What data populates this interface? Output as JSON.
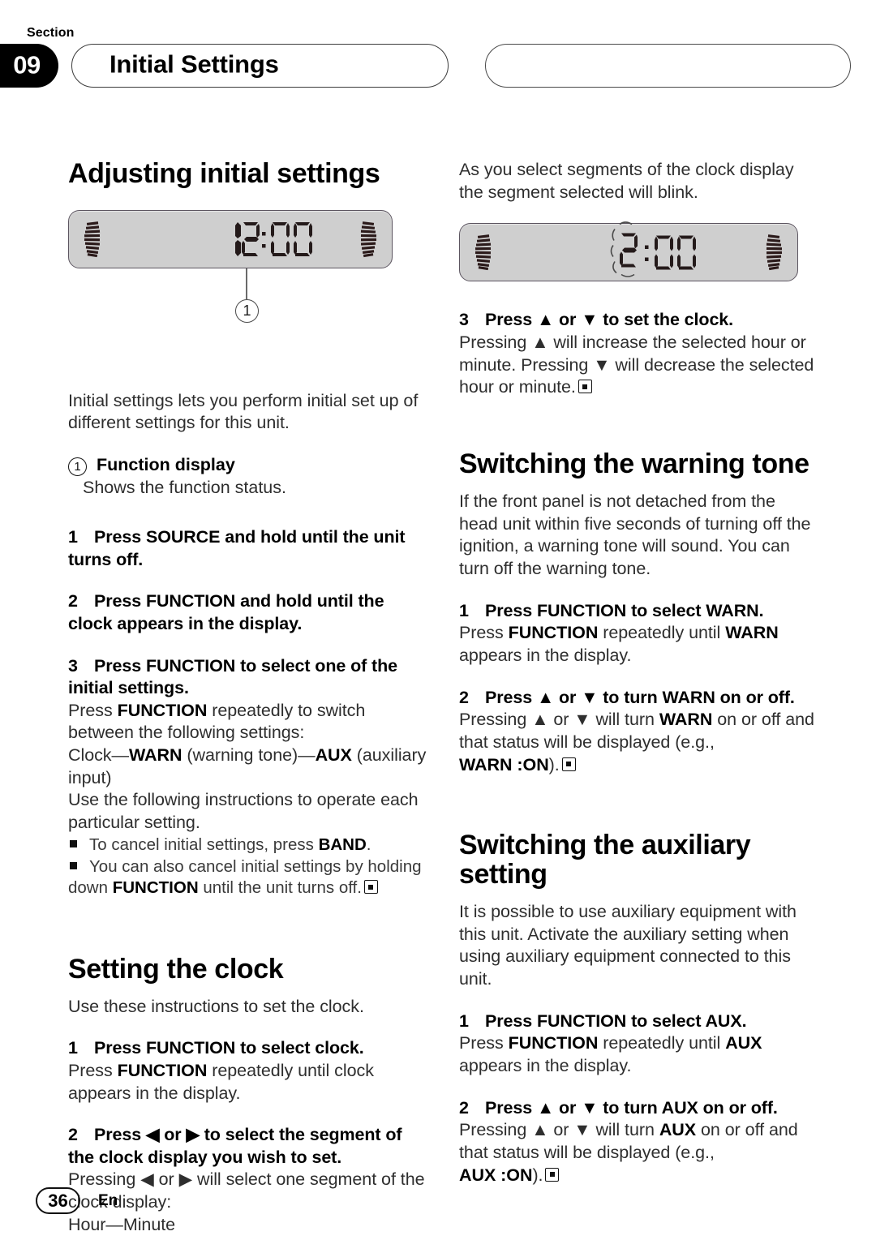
{
  "header": {
    "section_word": "Section",
    "section_number": "09",
    "title": "Initial Settings"
  },
  "left_column": {
    "heading": "Adjusting initial settings",
    "display": {
      "digits": "12:00",
      "callout_number": "1",
      "left_icon": "sound-wave-arc-icon",
      "right_icon": "sound-wave-arc-icon"
    },
    "intro": "Initial settings lets you perform initial set up of different settings for this unit.",
    "callout": {
      "marker": "1",
      "label": "Function display",
      "description": "Shows the function status."
    },
    "steps": [
      {
        "number": "1",
        "title_plain": "Press SOURCE and hold until the unit turns off.",
        "title_pre": "Press SOURCE and hold until the unit turns off."
      },
      {
        "number": "2",
        "title_plain": "Press FUNCTION and hold until the clock appears in the display."
      },
      {
        "number": "3",
        "title_plain": "Press FUNCTION to select one of the initial settings."
      }
    ],
    "step3_body": {
      "line1_a": "Press ",
      "line1_b": "FUNCTION",
      "line1_c": " repeatedly to switch between the following settings:",
      "settings_chain_a": "Clock—",
      "settings_chain_b": "WARN",
      "settings_chain_c": " (warning tone)—",
      "settings_chain_d": "AUX",
      "settings_chain_e": " (auxiliary input)",
      "line3": "Use the following instructions to operate each particular setting."
    },
    "notes": [
      {
        "a": "To cancel initial settings, press ",
        "b": "BAND",
        "c": "."
      },
      {
        "a": "You can also cancel initial settings by holding down ",
        "b": "FUNCTION",
        "c": " until the unit turns off."
      }
    ],
    "clock_section": {
      "heading": "Setting the clock",
      "intro": "Use these instructions to set the clock.",
      "step1": {
        "number": "1",
        "title": "Press FUNCTION to select clock.",
        "body_a": "Press ",
        "body_b": "FUNCTION",
        "body_c": " repeatedly until clock appears in the display."
      },
      "step2": {
        "number": "2",
        "title_a": "Press ",
        "title_arrow_left": "◀",
        "title_b": " or ",
        "title_arrow_right": "▶",
        "title_c": " to select the segment of the clock display you wish to set.",
        "body_a": "Pressing ",
        "body_b": " or ",
        "body_c": " will select one segment of the clock display:",
        "body_line2": "Hour—Minute"
      }
    }
  },
  "right_column": {
    "blink_note": "As you select segments of the clock display the segment selected will blink.",
    "display": {
      "digits": "2:00",
      "blinking_digit": "2",
      "left_icon": "sound-wave-arc-icon",
      "right_icon": "sound-wave-arc-icon"
    },
    "clock_step3": {
      "number": "3",
      "title_a": "Press ",
      "arrow_up": "▲",
      "title_b": " or ",
      "arrow_down": "▼",
      "title_c": " to set the clock.",
      "body_a": "Pressing ",
      "body_b": " will increase the selected hour or minute. Pressing ",
      "body_c": " will decrease the selected hour or minute."
    },
    "warning_section": {
      "heading": "Switching the warning tone",
      "intro": "If the front panel is not detached from the head unit within five seconds of turning off the ignition, a warning tone will sound. You can turn off the warning tone.",
      "step1": {
        "number": "1",
        "title": "Press FUNCTION to select WARN.",
        "body_a": "Press ",
        "body_b": "FUNCTION",
        "body_c": " repeatedly until ",
        "body_d": "WARN",
        "body_e": " appears in the display."
      },
      "step2": {
        "number": "2",
        "title_a": "Press ",
        "arrow_up": "▲",
        "title_b": " or ",
        "arrow_down": "▼",
        "title_c": " to turn WARN on or off.",
        "body_a": "Pressing ",
        "body_b": " or ",
        "body_c": " will turn ",
        "body_d": "WARN",
        "body_e": " on or off and that status will be displayed (e.g., ",
        "status_value": "WARN :ON",
        "body_f": ")."
      }
    },
    "aux_section": {
      "heading": "Switching the auxiliary setting",
      "intro": "It is possible to use auxiliary equipment with this unit. Activate the auxiliary setting when using auxiliary equipment connected to this unit.",
      "step1": {
        "number": "1",
        "title": "Press FUNCTION to select AUX.",
        "body_a": "Press ",
        "body_b": "FUNCTION",
        "body_c": " repeatedly until ",
        "body_d": "AUX",
        "body_e": " appears in the display."
      },
      "step2": {
        "number": "2",
        "title_a": "Press ",
        "arrow_up": "▲",
        "title_b": " or ",
        "arrow_down": "▼",
        "title_c": " to turn AUX on or off.",
        "body_a": "Pressing ",
        "body_b": " or ",
        "body_c": " will turn ",
        "body_d": "AUX",
        "body_e": " on or off and that status will be displayed (e.g., ",
        "status_value": "AUX :ON",
        "body_f": ")."
      }
    }
  },
  "footer": {
    "page_number": "36",
    "language": "En"
  }
}
